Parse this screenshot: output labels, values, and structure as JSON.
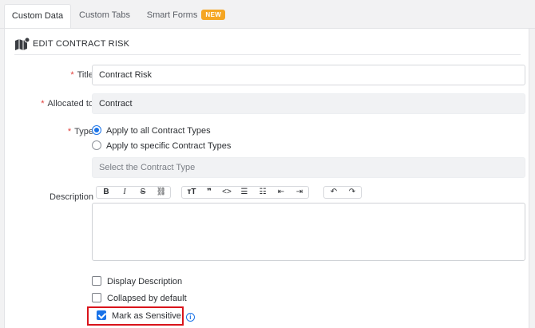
{
  "tabs": [
    {
      "label": "Custom Data",
      "active": true
    },
    {
      "label": "Custom Tabs",
      "active": false
    },
    {
      "label": "Smart Forms",
      "active": false,
      "badge": "NEW"
    }
  ],
  "section": {
    "title": "EDIT CONTRACT RISK",
    "icon": "map-edit-icon"
  },
  "form": {
    "title": {
      "label": "Title",
      "required_mark": "*",
      "value": "Contract Risk"
    },
    "allocated": {
      "label": "Allocated to",
      "required_mark": "*",
      "value": "Contract"
    },
    "type": {
      "label": "Type",
      "required_mark": "*",
      "options": [
        {
          "label": "Apply to all Contract Types",
          "selected": true
        },
        {
          "label": "Apply to specific Contract Types",
          "selected": false
        }
      ],
      "select_placeholder": "Select the Contract Type"
    },
    "description": {
      "label": "Description",
      "value": ""
    },
    "checkboxes": [
      {
        "label": "Display Description",
        "checked": false
      },
      {
        "label": "Collapsed by default",
        "checked": false
      },
      {
        "label": "Mark as Sensitive",
        "checked": true,
        "info": "i"
      }
    ]
  },
  "toolbar": {
    "groups": [
      [
        {
          "icon": "bold-icon",
          "glyph": "B"
        },
        {
          "icon": "italic-icon",
          "glyph": "I"
        },
        {
          "icon": "strikethrough-icon",
          "glyph": "S"
        },
        {
          "icon": "link-icon",
          "glyph": "⛓"
        }
      ],
      [
        {
          "icon": "heading-icon",
          "glyph": "ᴛT"
        },
        {
          "icon": "quote-icon",
          "glyph": "❞"
        },
        {
          "icon": "code-icon",
          "glyph": "<>"
        },
        {
          "icon": "bullet-list-icon",
          "glyph": "☰"
        },
        {
          "icon": "numbered-list-icon",
          "glyph": "☷"
        },
        {
          "icon": "outdent-icon",
          "glyph": "⇤"
        },
        {
          "icon": "indent-icon",
          "glyph": "⇥"
        }
      ],
      [
        {
          "icon": "undo-icon",
          "glyph": "↶"
        },
        {
          "icon": "redo-icon",
          "glyph": "↷"
        }
      ]
    ]
  },
  "colors": {
    "accent": "#1a73e8",
    "required": "#e0403c",
    "badge": "#f5a623",
    "highlight": "#d9141b"
  }
}
